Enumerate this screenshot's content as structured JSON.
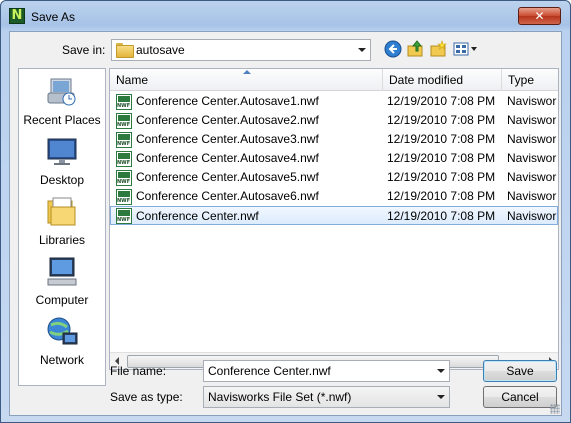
{
  "window": {
    "title": "Save As",
    "close_glyph": "✕",
    "app_icon_letter": "N"
  },
  "toolbar": {
    "save_in_label": "Save in:",
    "folder": "autosave",
    "icons": [
      "back-icon",
      "up-folder-icon",
      "new-folder-icon",
      "view-menu-icon"
    ]
  },
  "places": [
    {
      "label": "Recent Places",
      "icon": "recent-places-icon"
    },
    {
      "label": "Desktop",
      "icon": "desktop-icon"
    },
    {
      "label": "Libraries",
      "icon": "libraries-icon"
    },
    {
      "label": "Computer",
      "icon": "computer-icon"
    },
    {
      "label": "Network",
      "icon": "network-icon"
    }
  ],
  "columns": [
    "Name",
    "Date modified",
    "Type"
  ],
  "files": [
    {
      "name": "Conference Center.Autosave1.nwf",
      "date": "12/19/2010 7:08 PM",
      "type": "Navisworks File Set"
    },
    {
      "name": "Conference Center.Autosave2.nwf",
      "date": "12/19/2010 7:08 PM",
      "type": "Navisworks File Set"
    },
    {
      "name": "Conference Center.Autosave3.nwf",
      "date": "12/19/2010 7:08 PM",
      "type": "Navisworks File Set"
    },
    {
      "name": "Conference Center.Autosave4.nwf",
      "date": "12/19/2010 7:08 PM",
      "type": "Navisworks File Set"
    },
    {
      "name": "Conference Center.Autosave5.nwf",
      "date": "12/19/2010 7:08 PM",
      "type": "Navisworks File Set"
    },
    {
      "name": "Conference Center.Autosave6.nwf",
      "date": "12/19/2010 7:08 PM",
      "type": "Navisworks File Set"
    },
    {
      "name": "Conference Center.nwf",
      "date": "12/19/2010 7:08 PM",
      "type": "Navisworks File Set",
      "selected": true
    }
  ],
  "form": {
    "file_name_label": "File name:",
    "file_name_value": "Conference Center.nwf",
    "save_as_type_label": "Save as type:",
    "save_as_type_value": "Navisworks File Set (*.nwf)"
  },
  "buttons": {
    "save": "Save",
    "cancel": "Cancel"
  },
  "colors": {
    "selection_bg": "#dcebfc",
    "selection_border": "#84acdd",
    "nwf_green": "#2c7a3d"
  }
}
